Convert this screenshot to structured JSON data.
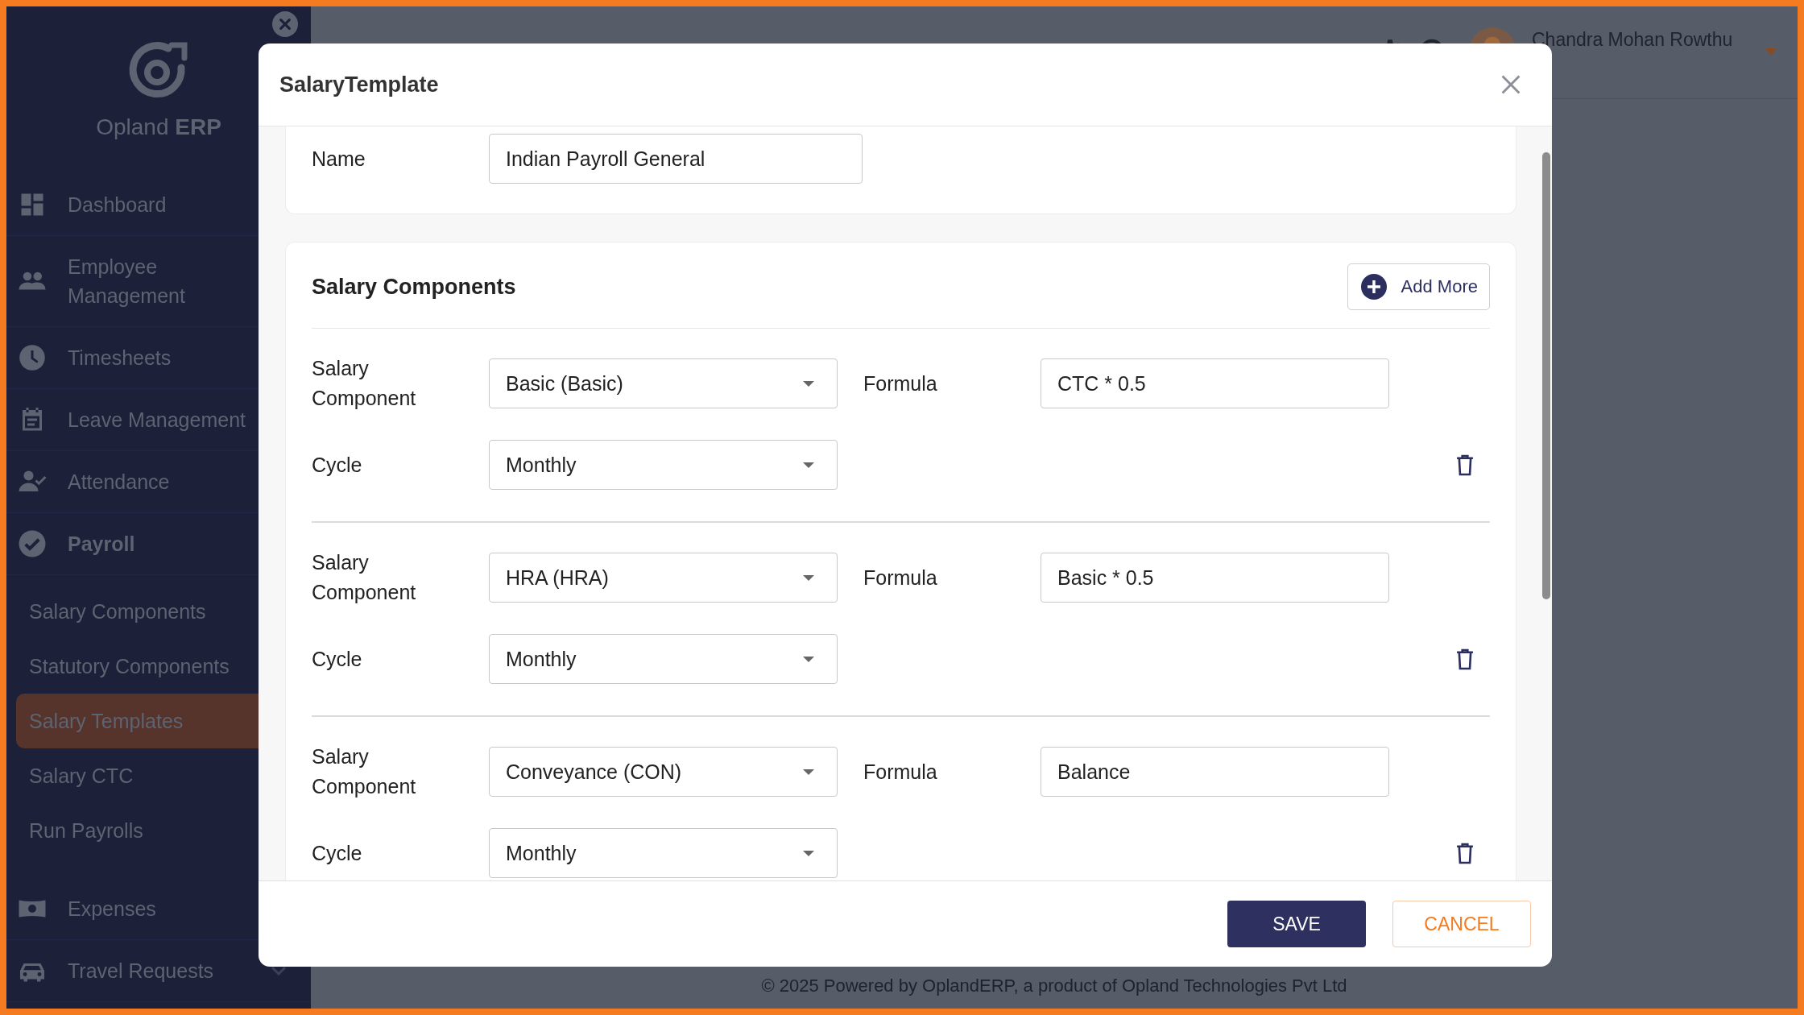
{
  "sidebar": {
    "brand": {
      "name": "Opland",
      "suffix": "ERP"
    },
    "items": [
      {
        "label": "Dashboard",
        "selected": false
      },
      {
        "label": "Employee Management",
        "selected": false
      },
      {
        "label": "Timesheets",
        "selected": false
      },
      {
        "label": "Leave Management",
        "selected": false
      },
      {
        "label": "Attendance",
        "selected": false
      },
      {
        "label": "Payroll",
        "selected": false,
        "expanded": true,
        "children": [
          {
            "label": "Salary Components",
            "selected": false
          },
          {
            "label": "Statutory Components",
            "selected": false
          },
          {
            "label": "Salary Templates",
            "selected": true
          },
          {
            "label": "Salary CTC",
            "selected": false
          },
          {
            "label": "Run Payrolls",
            "selected": false
          }
        ]
      },
      {
        "label": "Expenses",
        "selected": false
      },
      {
        "label": "Travel Requests",
        "selected": false,
        "expanded": false
      }
    ]
  },
  "topbar": {
    "user": {
      "name": "Chandra Mohan Rowthu"
    }
  },
  "modal": {
    "title": "SalaryTemplate",
    "name_field": {
      "label": "Name",
      "value": "Indian Payroll General"
    },
    "components": {
      "title": "Salary Components",
      "add_button": "Add More",
      "rows": [
        {
          "component_label": "Salary Component",
          "component": "Basic (Basic)",
          "formula_label": "Formula",
          "formula": "CTC * 0.5",
          "cycle_label": "Cycle",
          "cycle": "Monthly"
        },
        {
          "component_label": "Salary Component",
          "component": "HRA (HRA)",
          "formula_label": "Formula",
          "formula": "Basic * 0.5",
          "cycle_label": "Cycle",
          "cycle": "Monthly"
        },
        {
          "component_label": "Salary Component",
          "component": "Conveyance (CON)",
          "formula_label": "Formula",
          "formula": "Balance",
          "cycle_label": "Cycle",
          "cycle": "Monthly"
        }
      ]
    },
    "buttons": {
      "save": "SAVE",
      "cancel": "CANCEL"
    }
  },
  "footer": "© 2025 Powered by OplandERP, a product of Opland Technologies Pvt Ltd"
}
